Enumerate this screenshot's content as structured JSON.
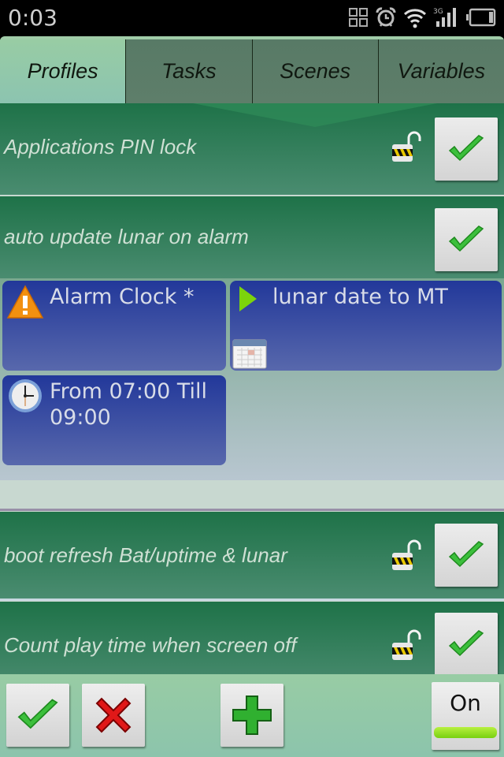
{
  "status_bar": {
    "time": "0:03",
    "icons": [
      "apps-grid-icon",
      "alarm-icon",
      "wifi-icon",
      "3g-signal-icon",
      "battery-icon"
    ],
    "network_label": "3G"
  },
  "tabs": [
    {
      "label": "Profiles",
      "active": true
    },
    {
      "label": "Tasks",
      "active": false
    },
    {
      "label": "Scenes",
      "active": false
    },
    {
      "label": "Variables",
      "active": false
    }
  ],
  "profiles": [
    {
      "name": "Applications PIN lock",
      "locked_icon": "unlocked-padlock-icon",
      "enabled": true
    },
    {
      "name": "auto update lunar on alarm",
      "enabled": true,
      "expanded": true,
      "contexts": [
        {
          "label": "Alarm Clock *",
          "icon": "warning-icon"
        },
        {
          "label": "From 07:00 Till 09:00",
          "icon": "clock-icon"
        }
      ],
      "task": {
        "label": "lunar date to MT",
        "icon": "play-icon",
        "sub_icon": "calendar-icon"
      }
    },
    {
      "name": "boot refresh Bat/uptime & lunar",
      "locked_icon": "unlocked-padlock-icon",
      "enabled": true
    },
    {
      "name": "Count play time when screen off",
      "locked_icon": "unlocked-padlock-icon",
      "enabled": true
    }
  ],
  "toolbar": {
    "buttons": [
      "confirm-button",
      "cancel-button",
      "add-button"
    ],
    "toggle_label": "On",
    "toggle_state": true
  },
  "colors": {
    "accent_green": "#78d010",
    "card_blue": "#22389a",
    "profile_green": "#1e7248"
  }
}
